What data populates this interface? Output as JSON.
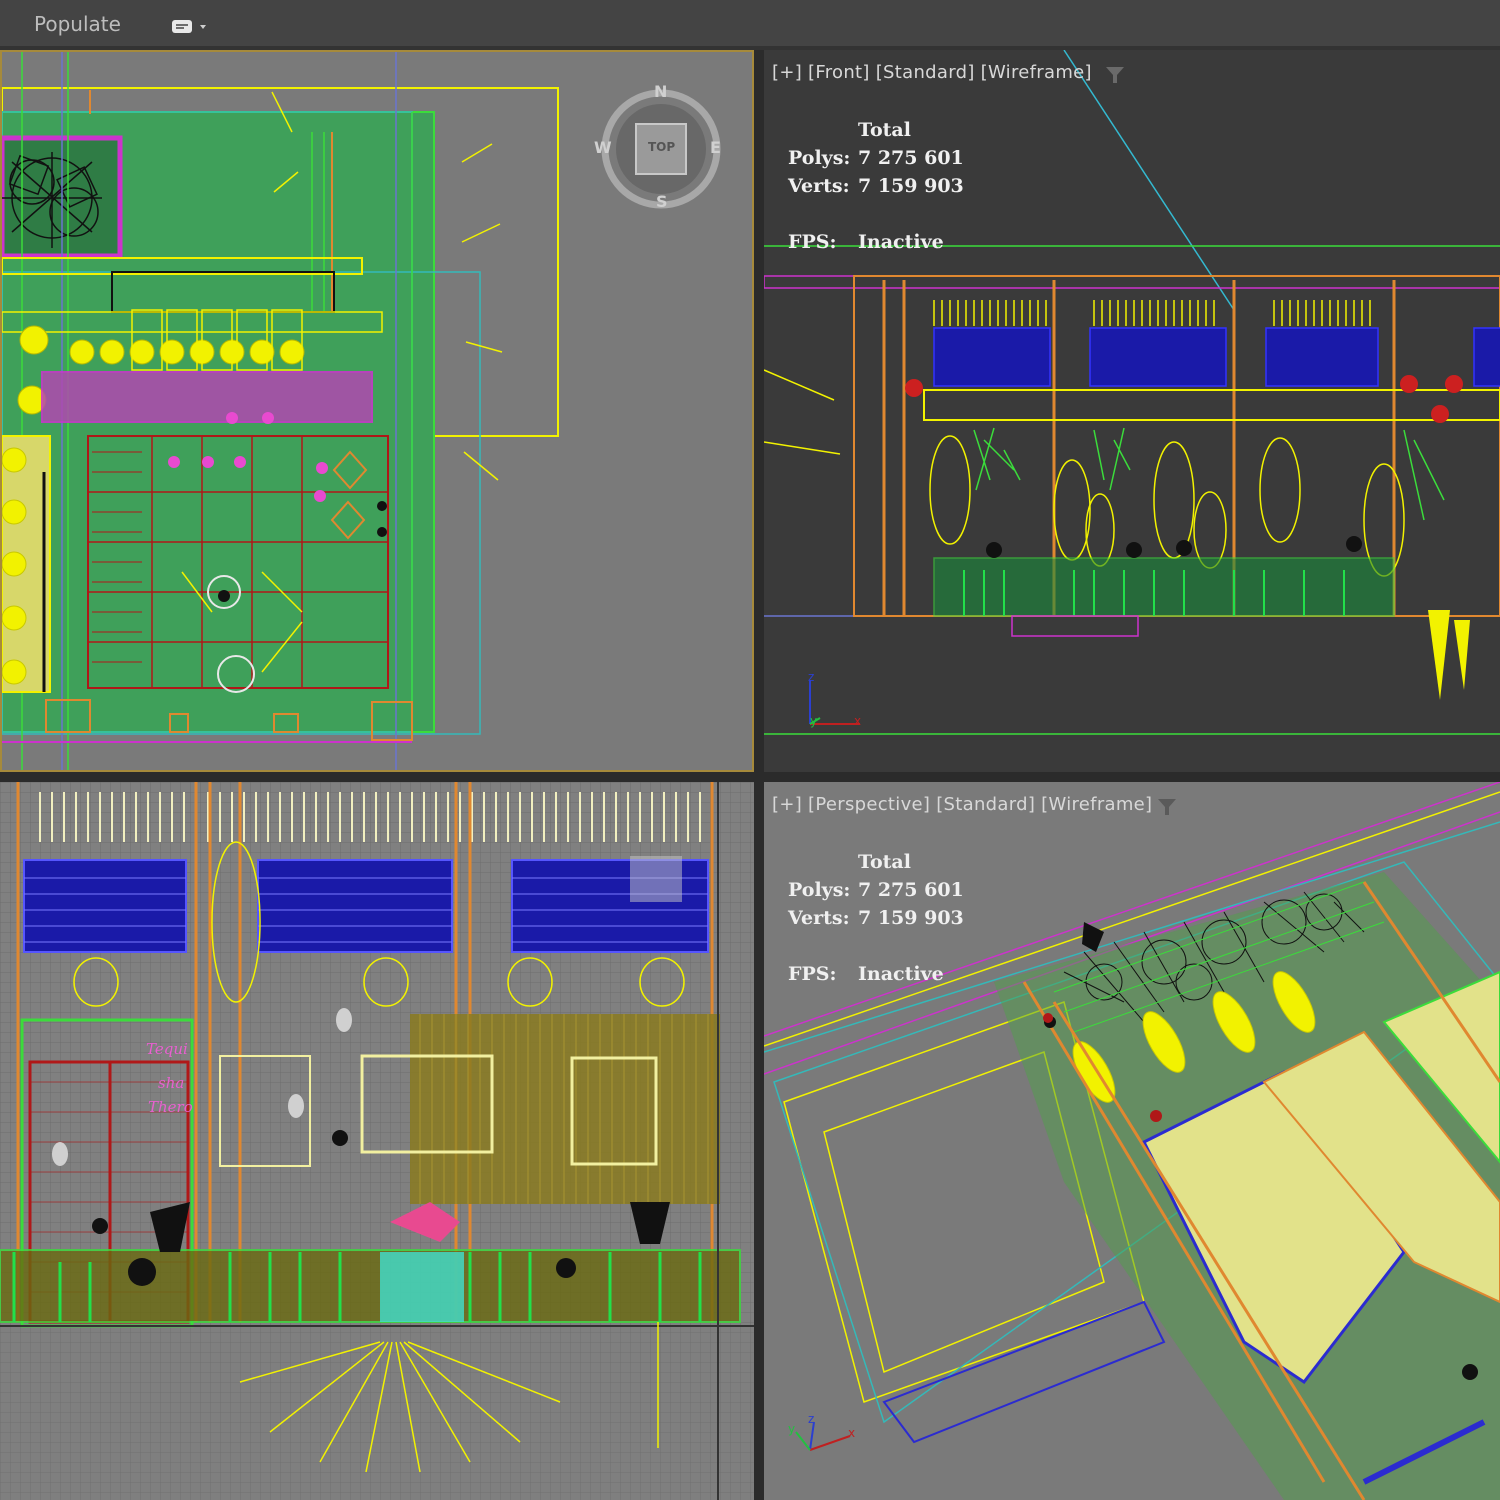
{
  "toolbar": {
    "populate_label": "Populate",
    "icon": "speech-bubble-icon"
  },
  "viewports": {
    "top": {
      "compass": {
        "n": "N",
        "s": "S",
        "e": "E",
        "w": "W",
        "cube_label": "TOP"
      }
    },
    "front": {
      "label": [
        "[+]",
        "[Front]",
        "[Standard]",
        "[Wireframe]"
      ],
      "stats": {
        "total_header": "Total",
        "polys_key": "Polys:",
        "polys_val": "7 275 601",
        "verts_key": "Verts:",
        "verts_val": "7 159 903",
        "fps_key": "FPS:",
        "fps_val": "Inactive"
      },
      "axis": {
        "z": "z",
        "y": "y",
        "x": "x"
      }
    },
    "perspective": {
      "label": [
        "[+]",
        "[Perspective]",
        "[Standard]",
        "[Wireframe]"
      ],
      "stats": {
        "total_header": "Total",
        "polys_key": "Polys:",
        "polys_val": "7 275 601",
        "verts_key": "Verts:",
        "verts_val": "7 159 903",
        "fps_key": "FPS:",
        "fps_val": "Inactive"
      },
      "axis": {
        "z": "z",
        "y": "y",
        "x": "x"
      }
    },
    "left": {
      "signage": [
        "Tequi",
        "sha",
        "Thero"
      ]
    }
  },
  "colors": {
    "active_border": "#a68a3b",
    "yellow": "#f5f500",
    "green": "#2ecc40",
    "blue": "#1a1aa8",
    "magenta": "#cc33cc",
    "orange": "#e07020",
    "red": "#b01818"
  }
}
